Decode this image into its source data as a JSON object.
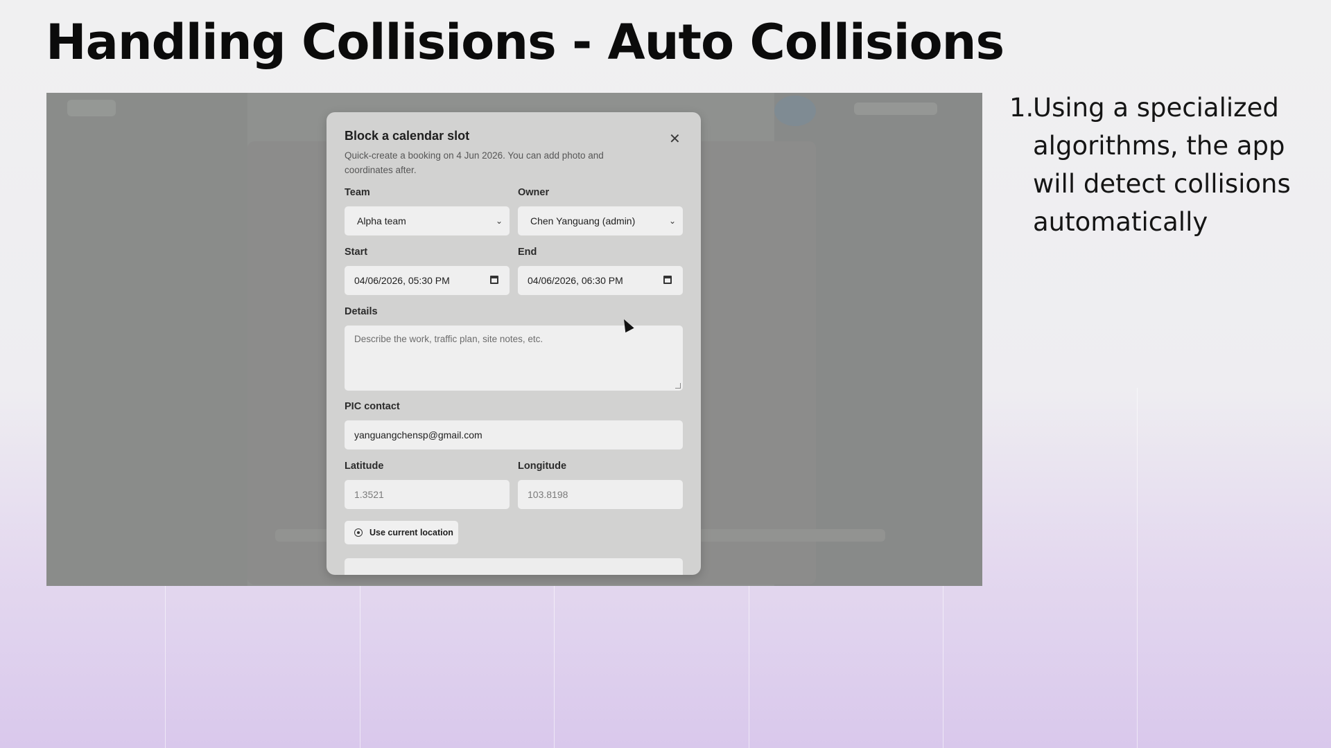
{
  "slide": {
    "title": "Handling Collisions - Auto Collisions",
    "notes": [
      {
        "number": "1.",
        "text": "Using a specialized algorithms, the app will detect collisions automatically"
      }
    ]
  },
  "modal": {
    "title": "Block a calendar slot",
    "subtitle": "Quick-create a booking on 4 Jun 2026. You can add photo and coordinates after.",
    "close_icon": "close-icon",
    "team": {
      "label": "Team",
      "value": "Alpha team"
    },
    "owner": {
      "label": "Owner",
      "value": "Chen Yanguang (admin)"
    },
    "start": {
      "label": "Start",
      "value": "04/06/2026, 05:30 PM"
    },
    "end": {
      "label": "End",
      "value": "04/06/2026, 06:30 PM"
    },
    "details": {
      "label": "Details",
      "placeholder": "Describe the work, traffic plan, site notes, etc."
    },
    "pic_contact": {
      "label": "PIC contact",
      "value": "yanguangchensp@gmail.com"
    },
    "latitude": {
      "label": "Latitude",
      "placeholder": "1.3521"
    },
    "longitude": {
      "label": "Longitude",
      "placeholder": "103.8198"
    },
    "use_location_label": "Use current location"
  }
}
